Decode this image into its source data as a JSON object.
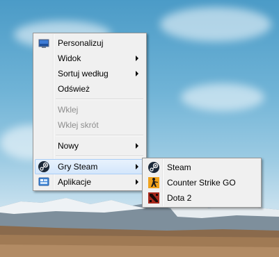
{
  "context_menu": {
    "items": [
      {
        "label": "Personalizuj",
        "icon": "personalize-icon"
      },
      {
        "label": "Widok",
        "submenu": true
      },
      {
        "label": "Sortuj według",
        "submenu": true
      },
      {
        "label": "Odśwież"
      },
      {
        "label": "Wklej",
        "disabled": true
      },
      {
        "label": "Wklej skrót",
        "disabled": true
      },
      {
        "label": "Nowy",
        "submenu": true
      },
      {
        "label": "Gry Steam",
        "submenu": true,
        "icon": "steam-icon",
        "highlighted": true
      },
      {
        "label": "Aplikacje",
        "submenu": true,
        "icon": "apps-icon"
      }
    ]
  },
  "steam_submenu": {
    "items": [
      {
        "label": "Steam",
        "icon": "steam-icon"
      },
      {
        "label": "Counter Strike GO",
        "icon": "csgo-icon"
      },
      {
        "label": "Dota 2",
        "icon": "dota2-icon"
      }
    ]
  },
  "colors": {
    "menu_background": "#f0f0f0",
    "highlight_border": "#a9cdf6",
    "highlight_fill": "#d4e6fb",
    "disabled_text": "#8d8d8d"
  }
}
